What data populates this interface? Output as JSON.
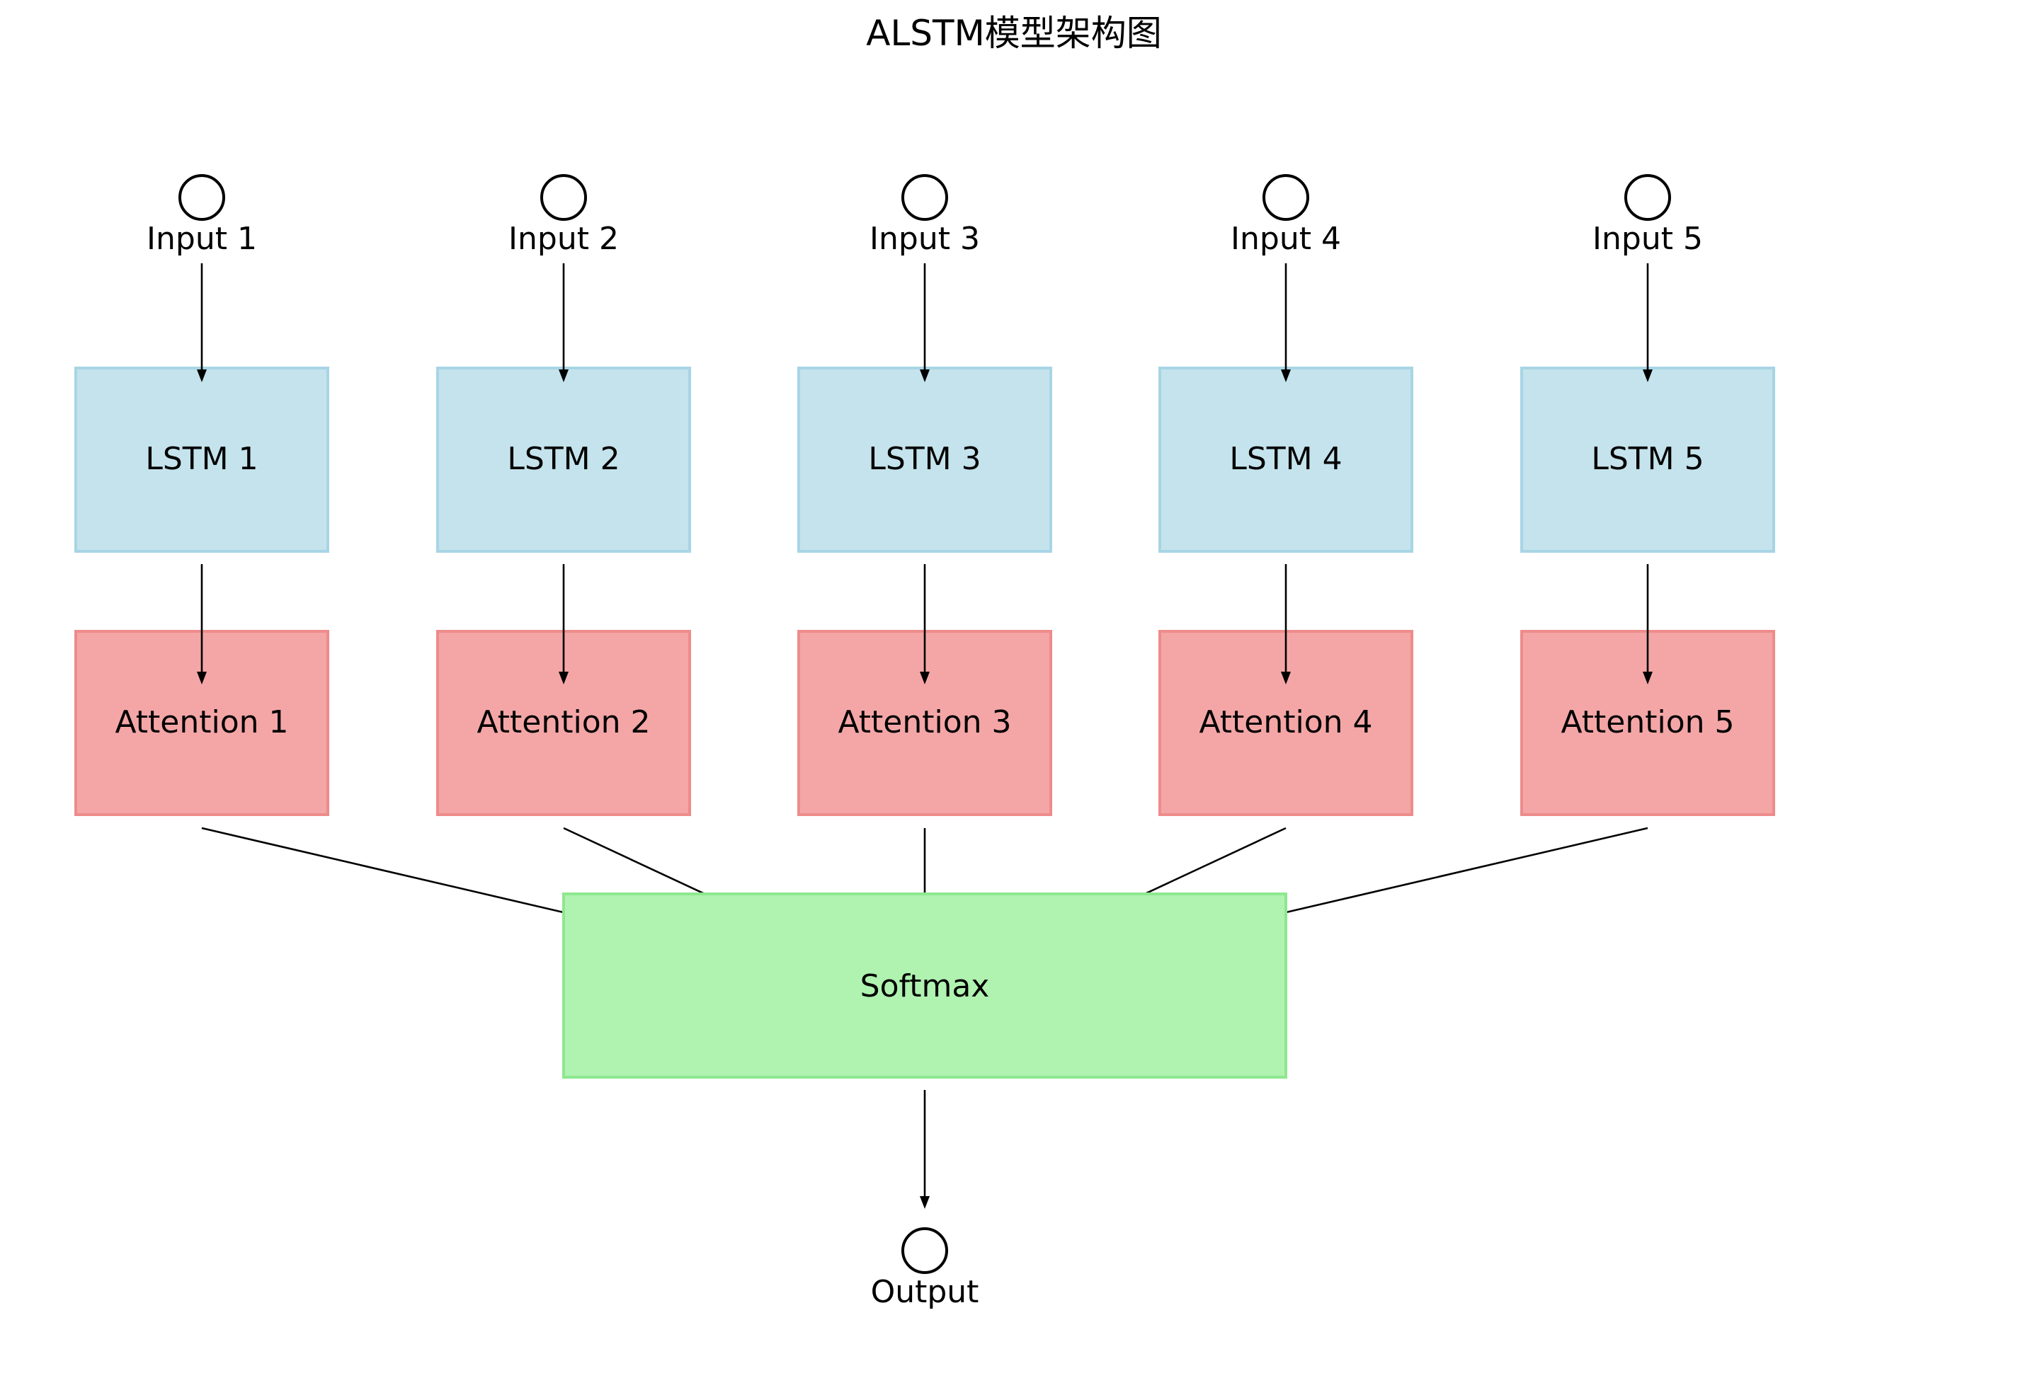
{
  "title": "ALSTM模型架构图",
  "inputs": [
    "Input 1",
    "Input 2",
    "Input 3",
    "Input 4",
    "Input 5"
  ],
  "lstm": [
    "LSTM 1",
    "LSTM 2",
    "LSTM 3",
    "LSTM 4",
    "LSTM 5"
  ],
  "attention": [
    "Attention 1",
    "Attention 2",
    "Attention 3",
    "Attention 4",
    "Attention 5"
  ],
  "softmax": "Softmax",
  "output": "Output",
  "colors": {
    "lstm_fill": "#c4e3ec",
    "attention_fill": "#f4a6a6",
    "softmax_fill": "#b0f2b0",
    "arrows": "#000000"
  }
}
